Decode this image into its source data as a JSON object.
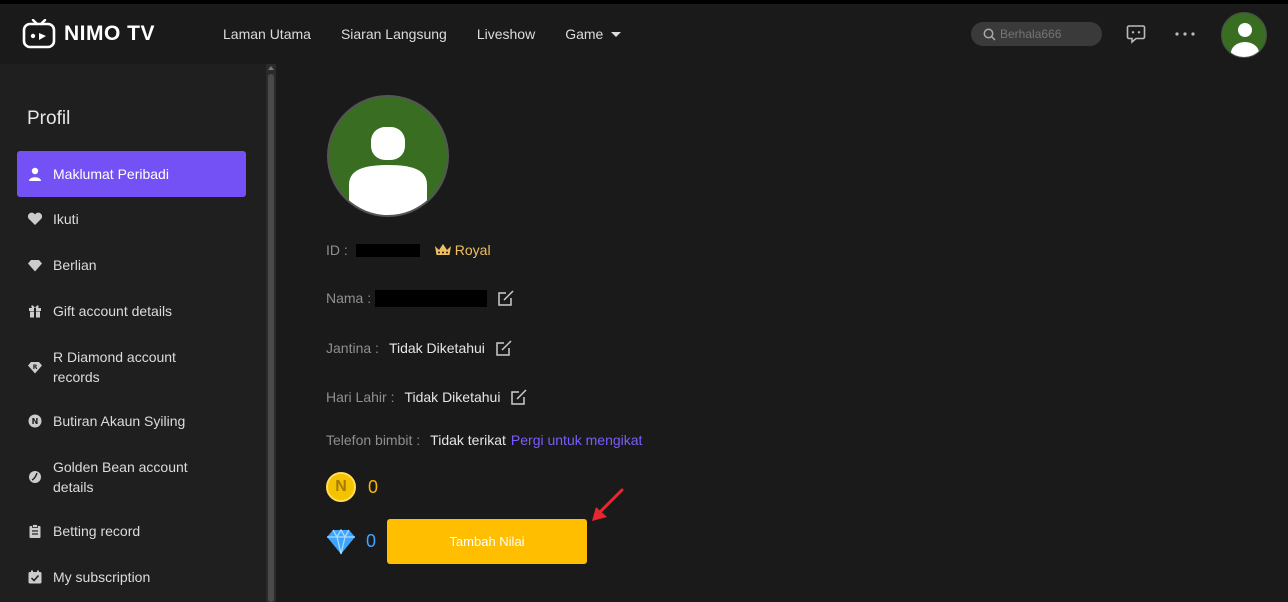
{
  "header": {
    "logo_text": "NIMO TV",
    "nav": [
      {
        "label": "Laman Utama"
      },
      {
        "label": "Siaran Langsung"
      },
      {
        "label": "Liveshow"
      },
      {
        "label": "Game"
      }
    ],
    "search_placeholder": "Berhala666"
  },
  "sidebar": {
    "title": "Profil",
    "items": [
      {
        "label": "Maklumat Peribadi",
        "icon": "user-icon",
        "active": true
      },
      {
        "label": "Ikuti",
        "icon": "heart-icon"
      },
      {
        "label": "Berlian",
        "icon": "diamond-icon"
      },
      {
        "label": "Gift account details",
        "icon": "gift-icon"
      },
      {
        "label": "R Diamond account records",
        "icon": "r-diamond-icon"
      },
      {
        "label": "Butiran Akaun Syiling",
        "icon": "n-coin-icon"
      },
      {
        "label": "Golden Bean account details",
        "icon": "bean-icon"
      },
      {
        "label": "Betting record",
        "icon": "clipboard-icon"
      },
      {
        "label": "My subscription",
        "icon": "subscription-icon"
      }
    ]
  },
  "profile": {
    "id_label": "ID :",
    "badge": "Royal",
    "name_label": "Nama :",
    "gender_label": "Jantina :",
    "gender_value": "Tidak Diketahui",
    "birthday_label": "Hari Lahir :",
    "birthday_value": "Tidak Diketahui",
    "phone_label": "Telefon bimbit :",
    "phone_value": "Tidak terikat",
    "phone_link": "Pergi untuk mengikat",
    "coin_value": "0",
    "coin_symbol": "N",
    "diamond_value": "0",
    "topup_label": "Tambah Nilai"
  },
  "colors": {
    "accent": "#7351f5",
    "topup": "#ffbe00",
    "coin": "#f5b800",
    "diamond": "#3da5ff",
    "avatar_bg": "#386d22"
  }
}
